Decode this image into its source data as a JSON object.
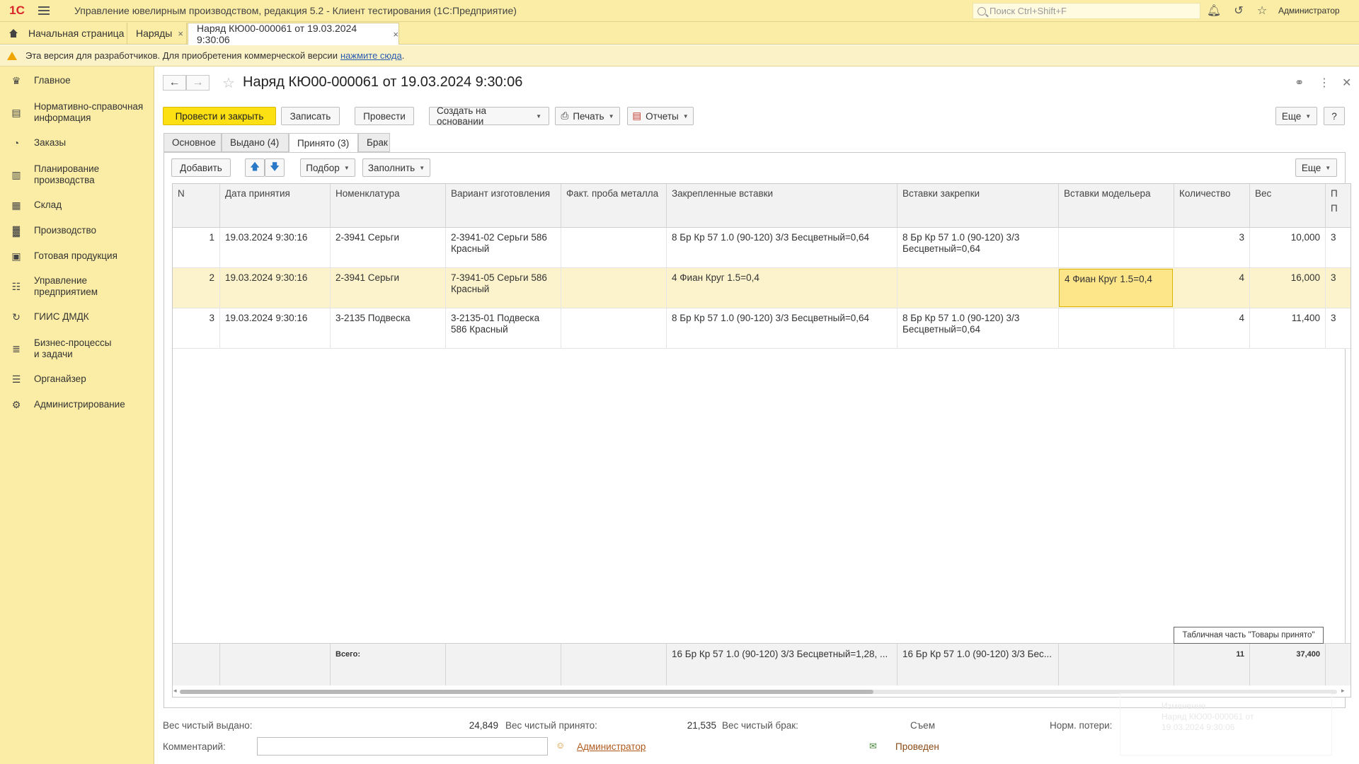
{
  "app": {
    "logo": "1С",
    "title": "Управление ювелирным производством, редакция 5.2  - Клиент тестирования (1С:Предприятие)",
    "search_placeholder": "Поиск Ctrl+Shift+F",
    "user": "Администратор"
  },
  "tabs": [
    {
      "label": "Начальная страница"
    },
    {
      "label": "Наряды",
      "close": "×"
    },
    {
      "label": "Наряд КЮ00-000061 от 19.03.2024 9:30:06",
      "close": "×"
    }
  ],
  "notice": {
    "text": "Эта версия для разработчиков. Для приобретения коммерческой версии",
    "link": "нажмите сюда",
    "tail": "."
  },
  "sidebar": {
    "items": [
      {
        "label": "Главное",
        "icon": "crown-icon"
      },
      {
        "label": "Нормативно-справочная информация",
        "icon": "book-icon"
      },
      {
        "label": "Заказы",
        "icon": "pie-icon"
      },
      {
        "label": "Планирование производства",
        "icon": "clipboard-icon"
      },
      {
        "label": "Склад",
        "icon": "grid-icon"
      },
      {
        "label": "Производство",
        "icon": "factory-icon"
      },
      {
        "label": "Готовая продукция",
        "icon": "bag-icon"
      },
      {
        "label": "Управление предприятием",
        "icon": "org-icon"
      },
      {
        "label": "ГИИС ДМДК",
        "icon": "refresh-icon"
      },
      {
        "label": "Бизнес-процессы и задачи",
        "icon": "tasks-icon"
      },
      {
        "label": "Органайзер",
        "icon": "list-icon"
      },
      {
        "label": "Администрирование",
        "icon": "gear-icon"
      }
    ]
  },
  "document": {
    "title": "Наряд КЮ00-000061 от 19.03.2024 9:30:06",
    "toolbar": {
      "post_close": "Провести и закрыть",
      "save": "Записать",
      "post": "Провести",
      "create_based": "Создать на основании",
      "print": "Печать",
      "reports": "Отчеты",
      "more": "Еще",
      "help": "?"
    },
    "form_tabs": [
      "Основное",
      "Выдано (4)",
      "Принято (3)",
      "Брак"
    ],
    "table_toolbar": {
      "add": "Добавить",
      "pick": "Подбор",
      "fill": "Заполнить",
      "more": "Еще"
    },
    "columns": [
      "N",
      "Дата принятия",
      "Номенклатура",
      "Вариант изготовления",
      "Факт. проба металла",
      "Закрепленные вставки",
      "Вставки закрепки",
      "Вставки модельера",
      "Количество",
      "Вес",
      "П",
      "П"
    ],
    "rows": [
      {
        "n": "1",
        "date": "19.03.2024 9:30:16",
        "item": "2-3941 Серьги",
        "variant": "2-3941-02 Серьги 586 Красный",
        "probe": "",
        "fixed": "8 Бр Кр 57 1.0 (90-120) 3/3 Бесцветный=0,64",
        "fixing": "8 Бр Кр 57 1.0 (90-120) 3/3 Бесцветный=0,64",
        "modeler": "",
        "qty": "3",
        "weight": "10,000",
        "extra": "3"
      },
      {
        "n": "2",
        "date": "19.03.2024 9:30:16",
        "item": "2-3941 Серьги",
        "variant": "7-3941-05 Серьги 586 Красный",
        "probe": "",
        "fixed": "4 Фиан Круг 1.5=0,4",
        "fixing": "",
        "modeler": "4 Фиан Круг 1.5=0,4",
        "qty": "4",
        "weight": "16,000",
        "extra": "3"
      },
      {
        "n": "3",
        "date": "19.03.2024 9:30:16",
        "item": "3-2135 Подвеска",
        "variant": "3-2135-01 Подвеска 586 Красный",
        "probe": "",
        "fixed": "8 Бр Кр 57 1.0 (90-120) 3/3 Бесцветный=0,64",
        "fixing": "8 Бр Кр 57 1.0 (90-120) 3/3 Бесцветный=0,64",
        "modeler": "",
        "qty": "4",
        "weight": "11,400",
        "extra": "3"
      }
    ],
    "totals": {
      "label": "Всего:",
      "fixed": "16 Бр Кр 57 1.0 (90-120) 3/3 Бесцветный=1,28, ...",
      "fixing": "16 Бр Кр 57 1.0 (90-120) 3/3 Бес...",
      "qty": "11",
      "weight": "37,400"
    },
    "tooltip": "Табличная часть \"Товары принято\"",
    "footer": {
      "net_issued_label": "Вес чистый выдано:",
      "net_issued": "24,849",
      "net_received_label": "Вес чистый принято:",
      "net_received": "21,535",
      "net_defect_label": "Вес чистый брак:",
      "removal_label": "Съем",
      "norm_loss_label": "Норм. потери:",
      "comment_label": "Комментарий:",
      "author": "Администратор",
      "status": "Проведен"
    },
    "ghost_notification": {
      "title": "Изменение",
      "body": "Наряд КЮ00-000061 от 19.03.2024 9:30:06"
    }
  }
}
